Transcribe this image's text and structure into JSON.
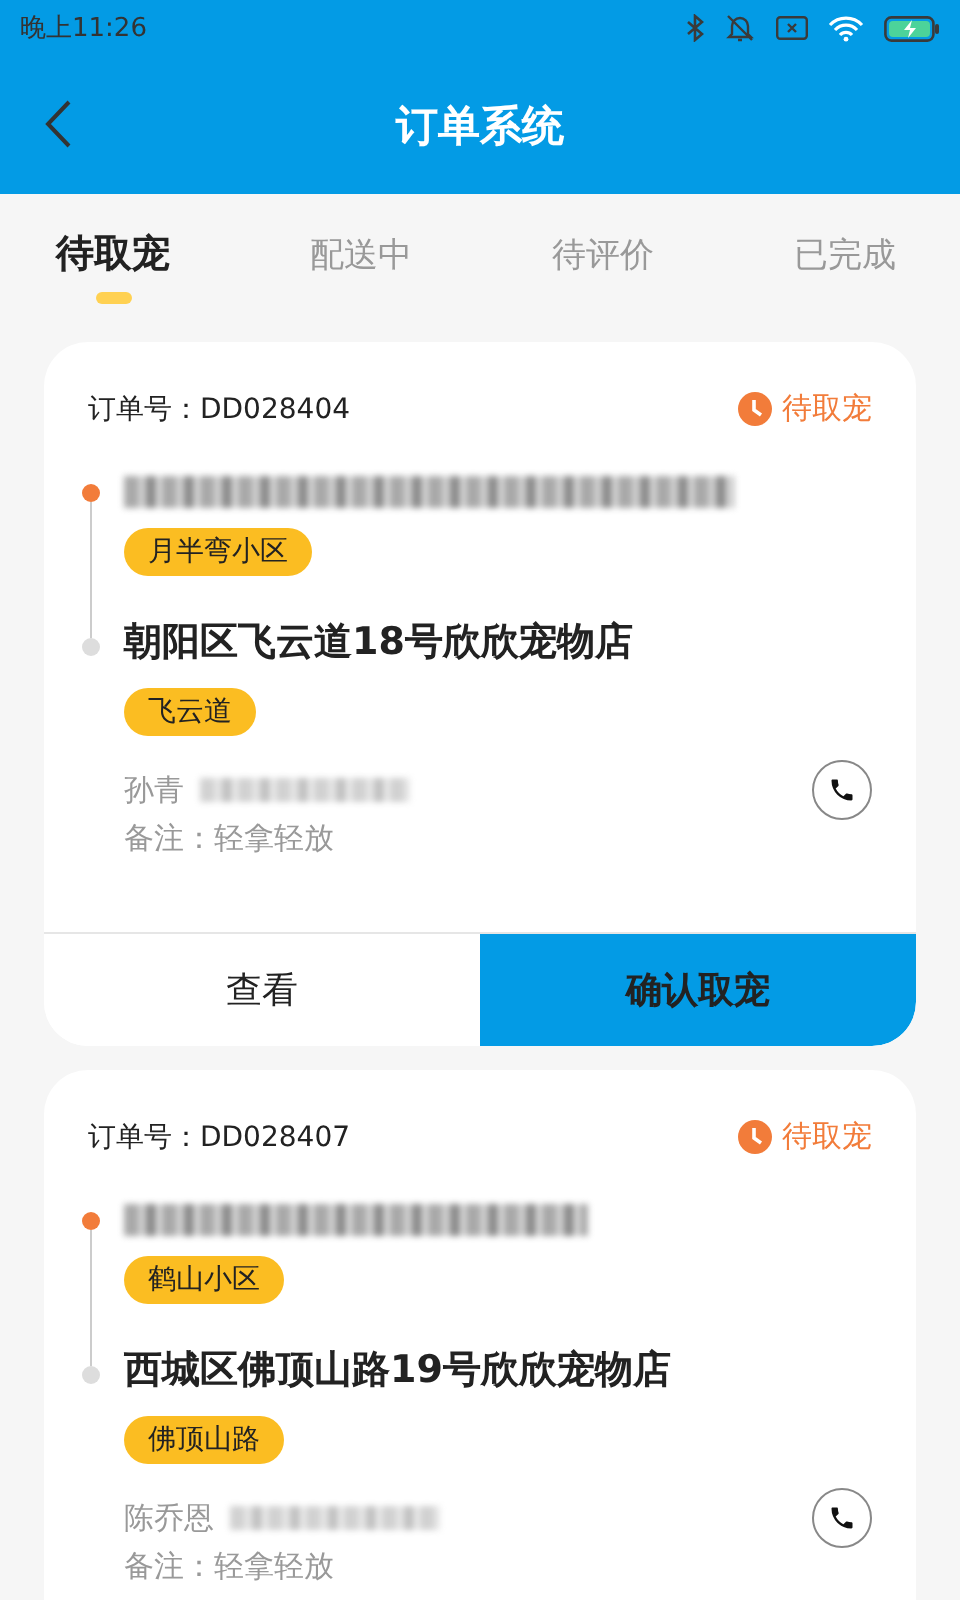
{
  "status_bar": {
    "time": "晚上11:26"
  },
  "header": {
    "title": "订单系统"
  },
  "tabs": [
    {
      "label": "待取宠",
      "selected": true
    },
    {
      "label": "配送中",
      "selected": false
    },
    {
      "label": "待评价",
      "selected": false
    },
    {
      "label": "已完成",
      "selected": false
    }
  ],
  "orders": [
    {
      "order_no": "订单号：DD028404",
      "status": "待取宠",
      "pickup_tag": "月半弯小区",
      "shop_address": "朝阳区飞云道18号欣欣宠物店",
      "shop_tag": "飞云道",
      "contact_name": "孙青",
      "note": "备注：轻拿轻放",
      "actions": [
        {
          "label": "查看",
          "kind": "plain"
        },
        {
          "label": "确认取宠",
          "kind": "primary"
        }
      ]
    },
    {
      "order_no": "订单号：DD028407",
      "status": "待取宠",
      "pickup_tag": "鹤山小区",
      "shop_address": "西城区佛顶山路19号欣欣宠物店",
      "shop_tag": "佛顶山路",
      "contact_name": "陈乔恩",
      "note": "备注：轻拿轻放"
    }
  ]
}
